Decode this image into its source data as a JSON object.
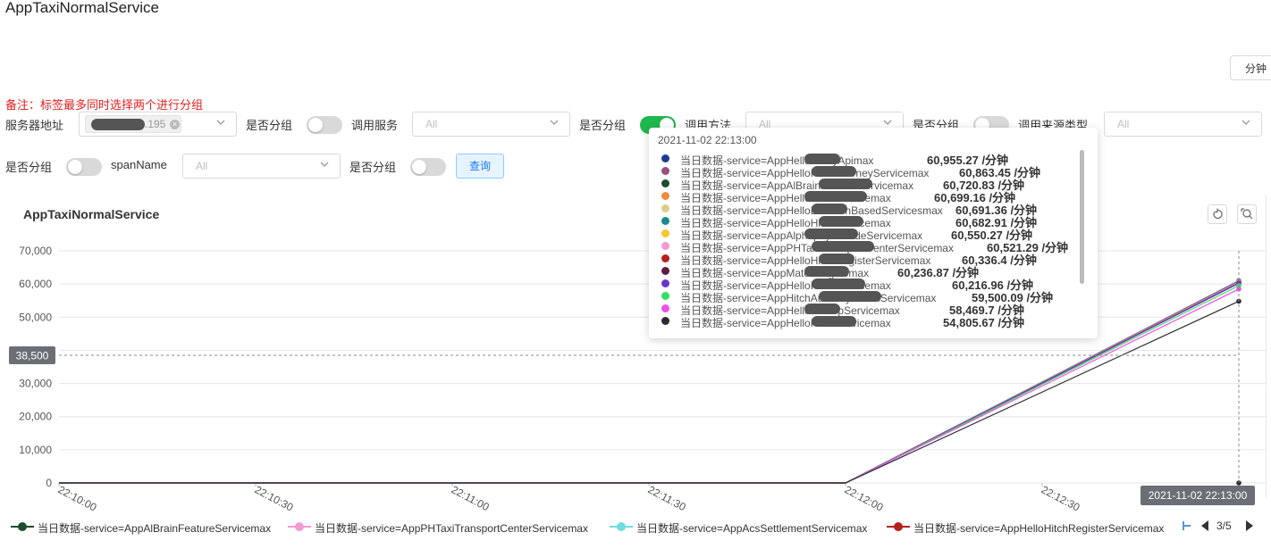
{
  "page": {
    "title": "AppTaxiNormalService",
    "unit_button": "分钟"
  },
  "note": "备注：标签最多同时选择两个进行分组",
  "filters": {
    "server_label": "服务器地址",
    "server_tag": ".195",
    "group_label": "是否分组",
    "service_label": "调用服务",
    "method_label": "调用方法",
    "source_label": "调用来源类型",
    "span_label": "spanName",
    "placeholder": "All",
    "query_button": "查询"
  },
  "switches": {
    "server_group": false,
    "service_group": true,
    "method_group": false,
    "source_group": false,
    "span_group": false
  },
  "chart": {
    "title": "AppTaxiNormalService"
  },
  "chart_data": {
    "type": "line",
    "title": "AppTaxiNormalService",
    "x": [
      "22:10:00",
      "22:10:30",
      "22:11:00",
      "22:11:30",
      "22:12:00",
      "22:12:30",
      "22:13:00"
    ],
    "x_axis_labels": [
      "22:10:00",
      "22:10:30",
      "22:11:00",
      "22:11:30",
      "22:12:00",
      "22:12:30"
    ],
    "y_ticks": [
      0,
      10000,
      20000,
      30000,
      40000,
      50000,
      60000,
      70000
    ],
    "y_tick_labels": [
      "0",
      "10,000",
      "20,000",
      "30,000",
      "40,000",
      "50,000",
      "60,000",
      "70,000"
    ],
    "ylim": [
      0,
      70000
    ],
    "crosshair_y": 38500,
    "crosshair_y_label": "38,500",
    "crosshair_x_label": "2021-11-02 22:13:00",
    "grid": true,
    "legend_position": "bottom",
    "series": [
      {
        "name": "当日数据-service=AppHellomerryApimax",
        "color": "#1f3a93",
        "values": [
          0,
          0,
          0,
          0,
          0,
          null,
          60955.27
        ]
      },
      {
        "name": "当日数据-service=AppHelloHitchJourneyServicemax",
        "color": "#9b4f7a",
        "values": [
          0,
          0,
          0,
          0,
          0,
          null,
          60863.45
        ]
      },
      {
        "name": "当日数据-service=AppAlBrainFeatureServicemax",
        "color": "#1d4d2f",
        "values": [
          0,
          0,
          0,
          0,
          0,
          null,
          60720.83
        ]
      },
      {
        "name": "当日数据-service=AppHelloHitchServicemax",
        "color": "#f08a3c",
        "values": [
          0,
          0,
          0,
          0,
          0,
          null,
          60699.16
        ]
      },
      {
        "name": "当日数据-service=AppHelloLocationBasedServicesmax",
        "color": "#d6cf8a",
        "values": [
          0,
          0,
          0,
          0,
          0,
          null,
          60691.36
        ]
      },
      {
        "name": "当日数据-service=AppHelloHitchServicemax",
        "color": "#1b8a8f",
        "values": [
          0,
          0,
          0,
          0,
          0,
          null,
          60682.91
        ]
      },
      {
        "name": "当日数据-service=AppAlphapayFacadeServicemax",
        "color": "#f7c631",
        "values": [
          0,
          0,
          0,
          0,
          0,
          null,
          60550.27
        ]
      },
      {
        "name": "当日数据-service=AppPHTaxiTransportCenterServicemax",
        "color": "#f39ad0",
        "values": [
          0,
          0,
          0,
          0,
          0,
          null,
          60521.29
        ]
      },
      {
        "name": "当日数据-service=AppHelloHitchRegisterServicemax",
        "color": "#b3211f",
        "values": [
          0,
          0,
          0,
          0,
          0,
          null,
          60336.4
        ]
      },
      {
        "name": "当日数据-service=AppMatchEnginemax",
        "color": "#5a1f3d",
        "values": [
          0,
          0,
          0,
          0,
          0,
          null,
          60236.87
        ]
      },
      {
        "name": "当日数据-service=AppHelloHitchServicemax",
        "color": "#6a35c9",
        "values": [
          0,
          0,
          0,
          0,
          0,
          null,
          60216.96
        ]
      },
      {
        "name": "当日数据-service=AppHitchAuxiliaryModelServicemax",
        "color": "#33e05a",
        "values": [
          0,
          0,
          0,
          0,
          0,
          null,
          59500.09
        ]
      },
      {
        "name": "当日数据-service=AppHellobikeUpServicemax",
        "color": "#ee4fe6",
        "values": [
          0,
          0,
          0,
          0,
          0,
          null,
          58469.7
        ]
      },
      {
        "name": "当日数据-service=AppHelloHitchServicemax",
        "color": "#2a2a35",
        "values": [
          0,
          0,
          0,
          0,
          0,
          null,
          54805.67
        ]
      }
    ]
  },
  "tooltip": {
    "time": "2021-11-02 22:13:00",
    "rows": [
      {
        "name": "当日数据-service=AppHellomerryApimax",
        "value": "60,955.27 /分钟",
        "color": "#1f3a93"
      },
      {
        "name": "当日数据-service=AppHelloHitchJourneyServicemax",
        "value": "60,863.45 /分钟",
        "color": "#9b4f7a"
      },
      {
        "name": "当日数据-service=AppAlBrainFeatureServicemax",
        "value": "60,720.83 /分钟",
        "color": "#1d4d2f"
      },
      {
        "name": "当日数据-service=AppHelloHitchServicemax",
        "value": "60,699.16 /分钟",
        "color": "#f08a3c"
      },
      {
        "name": "当日数据-service=AppHelloLocationBasedServicesmax",
        "value": "60,691.36 /分钟",
        "color": "#d6cf8a"
      },
      {
        "name": "当日数据-service=AppHelloHitchServicemax",
        "value": "60,682.91 /分钟",
        "color": "#1b8a8f"
      },
      {
        "name": "当日数据-service=AppAlphapayFacadeServicemax",
        "value": "60,550.27 /分钟",
        "color": "#f7c631"
      },
      {
        "name": "当日数据-service=AppPHTaxiTransportCenterServicemax",
        "value": "60,521.29 /分钟",
        "color": "#f39ad0"
      },
      {
        "name": "当日数据-service=AppHelloHitchRegisterServicemax",
        "value": "60,336.4 /分钟",
        "color": "#b3211f"
      },
      {
        "name": "当日数据-service=AppMatchEnginemax",
        "value": "60,236.87 /分钟",
        "color": "#5a1f3d"
      },
      {
        "name": "当日数据-service=AppHelloHitchServicemax",
        "value": "60,216.96 /分钟",
        "color": "#6a35c9"
      },
      {
        "name": "当日数据-service=AppHitchAuxiliaryModelServicemax",
        "value": "59,500.09 /分钟",
        "color": "#33e05a"
      },
      {
        "name": "当日数据-service=AppHellobikeUpServicemax",
        "value": "58,469.7 /分钟",
        "color": "#ee4fe6"
      },
      {
        "name": "当日数据-service=AppHelloHitchServicemax",
        "value": "54,805.67 /分钟",
        "color": "#2a2a35"
      }
    ]
  },
  "legend": {
    "items": [
      {
        "label": "当日数据-service=AppAlBrainFeatureServicemax",
        "color": "#1d4d2f"
      },
      {
        "label": "当日数据-service=AppPHTaxiTransportCenterServicemax",
        "color": "#f39ad0"
      },
      {
        "label": "当日数据-service=AppAcsSettlementServicemax",
        "color": "#6fdde0"
      },
      {
        "label": "当日数据-service=AppHelloHitchRegisterServicemax",
        "color": "#b3211f"
      }
    ],
    "page": "3/5"
  }
}
